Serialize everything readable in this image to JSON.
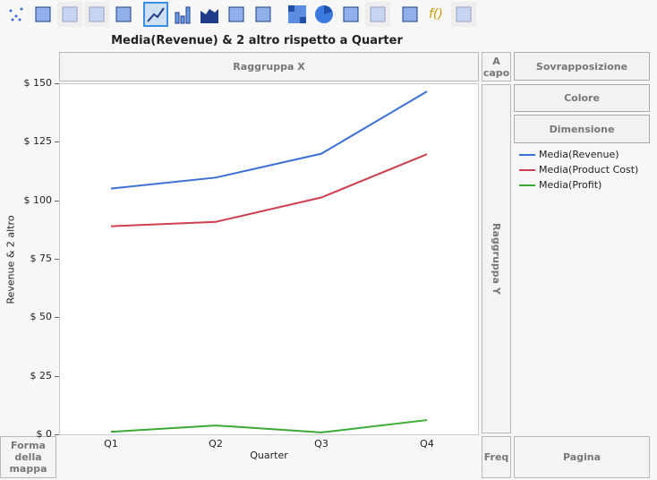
{
  "toolbar": {
    "icons": [
      "points-icon",
      "smoother-icon",
      "line-of-fit-icon",
      "ellipse-icon",
      "contour-icon",
      "line-icon",
      "bar-icon",
      "area-icon",
      "box-plot-icon",
      "histogram-icon",
      "heatmap-icon",
      "pie-icon",
      "treemap-icon",
      "mosaic-icon",
      "caption-box-icon",
      "formula-icon",
      "map-shapes-icon"
    ]
  },
  "title": "Media(Revenue) & 2 altro rispetto a Quarter",
  "zones": {
    "group_x": "Raggruppa X",
    "wrap": "A capo",
    "overlay": "Sovrapposizione",
    "color": "Colore",
    "size": "Dimensione",
    "group_y": "Raggruppa Y",
    "map_shape": "Forma della mappa",
    "freq": "Freq",
    "page": "Pagina"
  },
  "chart_data": {
    "type": "line",
    "title": "Media(Revenue) & 2 altro rispetto a Quarter",
    "xlabel": "Quarter",
    "ylabel": "Revenue & 2 altro",
    "categories": [
      "Q1",
      "Q2",
      "Q3",
      "Q4"
    ],
    "ylim": [
      0,
      150
    ],
    "yticks": [
      "$ 0",
      "$ 25",
      "$ 50",
      "$ 75",
      "$ 100",
      "$ 125",
      "$ 150"
    ],
    "series": [
      {
        "name": "Media(Revenue)",
        "color": "#3b6fd6",
        "values": [
          105,
          109.7,
          119.9,
          146.5
        ]
      },
      {
        "name": "Media(Product Cost)",
        "color": "#cc4050",
        "values": [
          88.9,
          90.8,
          101.2,
          119.7
        ]
      },
      {
        "name": "Media(Profit)",
        "color": "#3aaa35",
        "values": [
          1.1,
          3.8,
          0.8,
          6.1
        ]
      }
    ]
  }
}
